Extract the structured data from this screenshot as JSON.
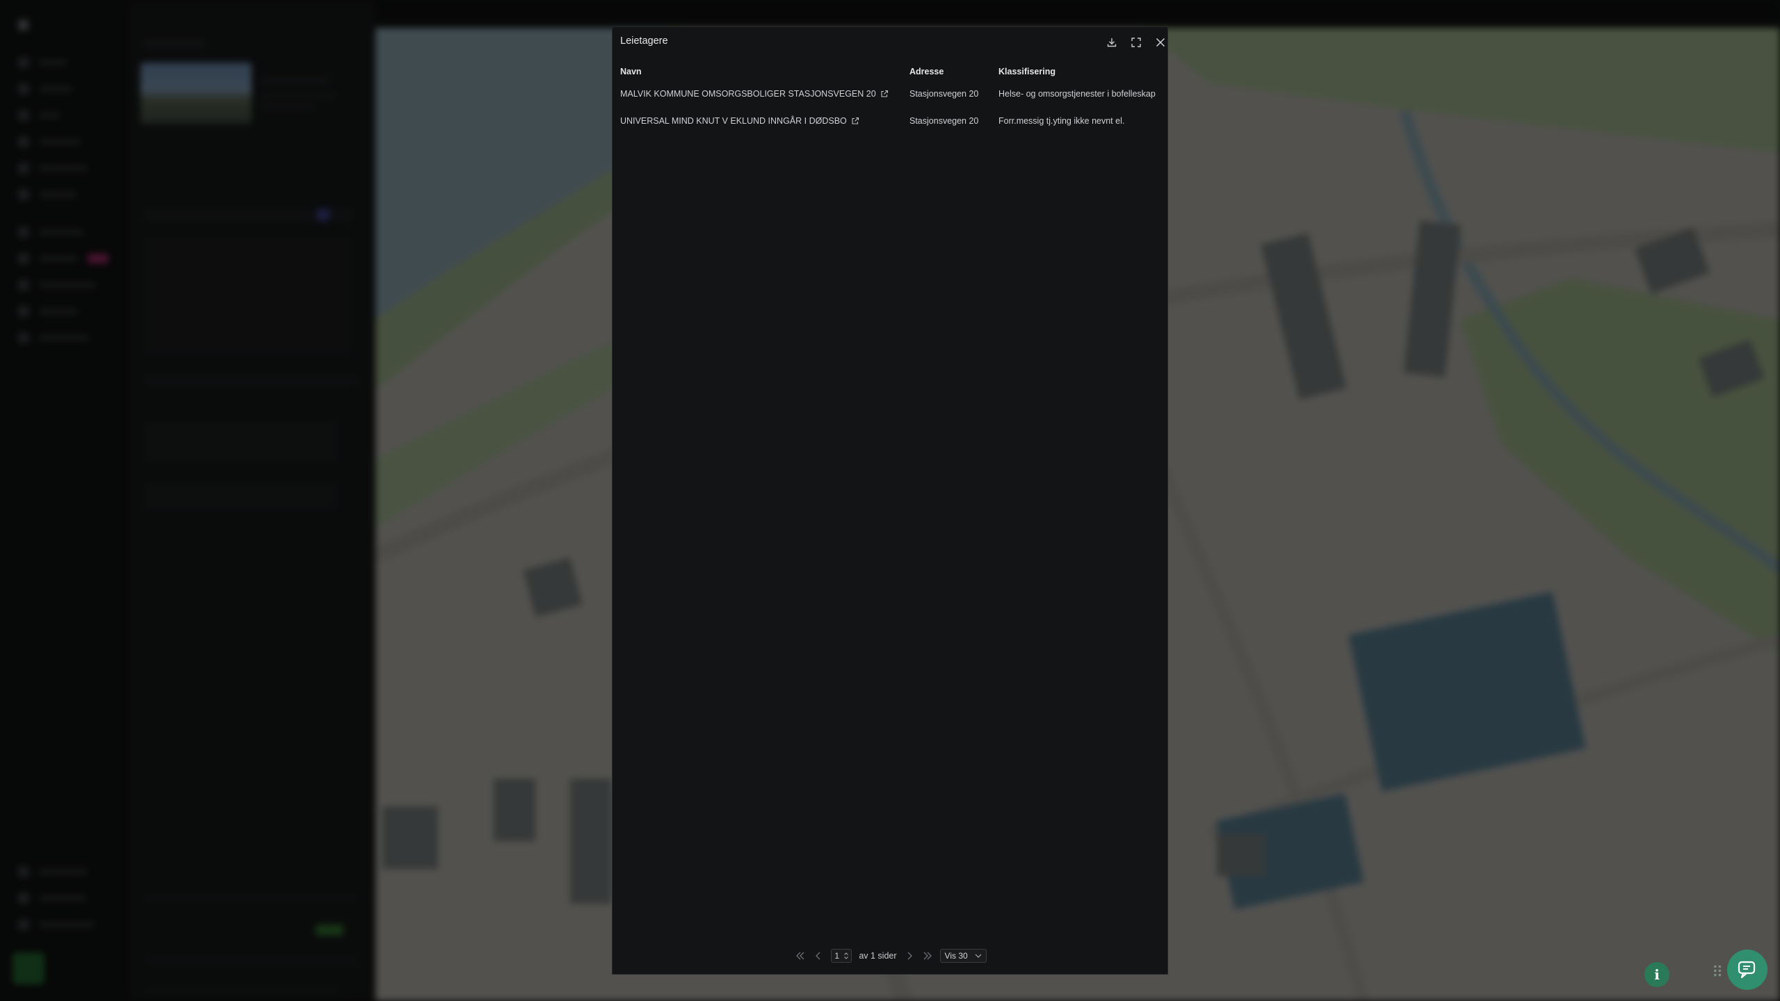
{
  "modal": {
    "title": "Leietagere",
    "columns": [
      "Navn",
      "Adresse",
      "Klassifisering"
    ],
    "rows": [
      {
        "name": "MALVIK KOMMUNE OMSORGSBOLIGER STASJONSVEGEN 20",
        "address": "Stasjonsvegen 20",
        "classification": "Helse- og omsorgstjenester i bofelleskap"
      },
      {
        "name": "UNIVERSAL MIND KNUT V EKLUND INNGÅR I DØDSBO",
        "address": "Stasjonsvegen 20",
        "classification": "Forr.messig tj.yting ikke nevnt el."
      }
    ],
    "pagination": {
      "current_page": "1",
      "of_pages": "av 1 sider",
      "per_page": "Vis 30"
    },
    "icons": {
      "download": "download-icon",
      "expand": "expand-icon",
      "close": "close-icon",
      "external": "external-link-icon"
    }
  },
  "colors": {
    "modal_bg": "#131416",
    "accent_green": "#2f8f6f",
    "map_water": "#9fc3d6",
    "map_green": "#b5d3a0",
    "map_building": "#5d87a0"
  }
}
